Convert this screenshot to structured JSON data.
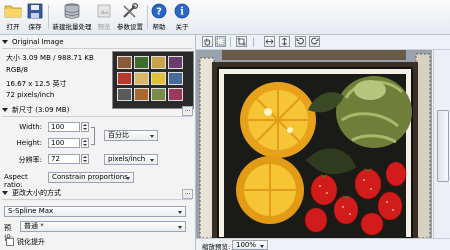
{
  "toolbar": {
    "open_label": "打开",
    "save_label": "保存",
    "new_batch_label": "新建批量处理",
    "preview_label": "预览",
    "settings_label": "参数设置",
    "help_label": "帮助",
    "about_label": "关于"
  },
  "original": {
    "header": "Original Image",
    "size": "大小 3.09 MB / 988.71 KB",
    "mode": "RGB/8",
    "dimensions": "16.67 x 12.5 英寸",
    "resolution": "72 pixels/inch"
  },
  "new_size": {
    "header": "新尺寸 (3.09 MB)",
    "width_label": "Width:",
    "width_value": "100",
    "height_label": "Height:",
    "height_value": "100",
    "resolution_label": "分辨率:",
    "resolution_value": "72",
    "unit_select": "百分比",
    "res_unit_select": "pixels/inch",
    "aspect_label": "Aspect ratio:",
    "aspect_value": "Constrain proportions"
  },
  "resize_method": {
    "header": "更改大小的方式",
    "method_value": "S-Spline Max",
    "preset_label": "预设:",
    "preset_value": "普通 *",
    "sharpen_label": "锐化提升"
  },
  "statusbar": {
    "zoom_label": "缩放预览:",
    "zoom_value": "100%"
  },
  "colors": {
    "accent_blue": "#1f5fbf",
    "toolbar_bg": "#e6eaf0",
    "canvas_bg": "#8f9aa6"
  }
}
